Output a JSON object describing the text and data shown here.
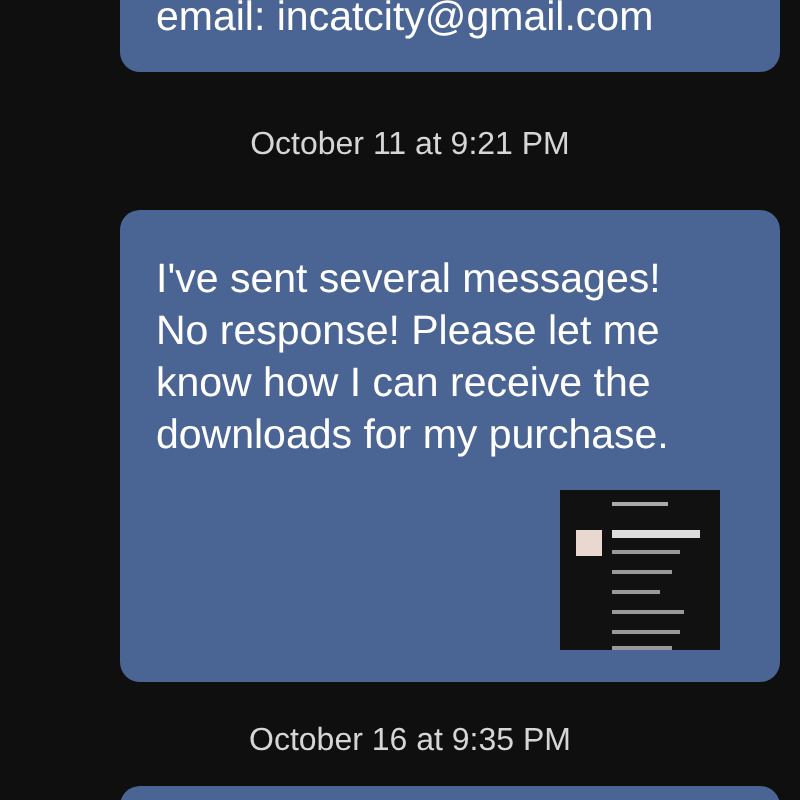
{
  "messages": [
    {
      "kind": "text",
      "text": "email: incatcity@gmail.com"
    },
    {
      "kind": "timestamp",
      "text": "October 11 at 9:21 PM"
    },
    {
      "kind": "text",
      "text": "I've sent several messages! No response! Please let me know how I can receive the downloads for my purchase.",
      "attachment": true
    },
    {
      "kind": "timestamp",
      "text": "October 16 at 9:35 PM"
    },
    {
      "kind": "text"
    }
  ]
}
